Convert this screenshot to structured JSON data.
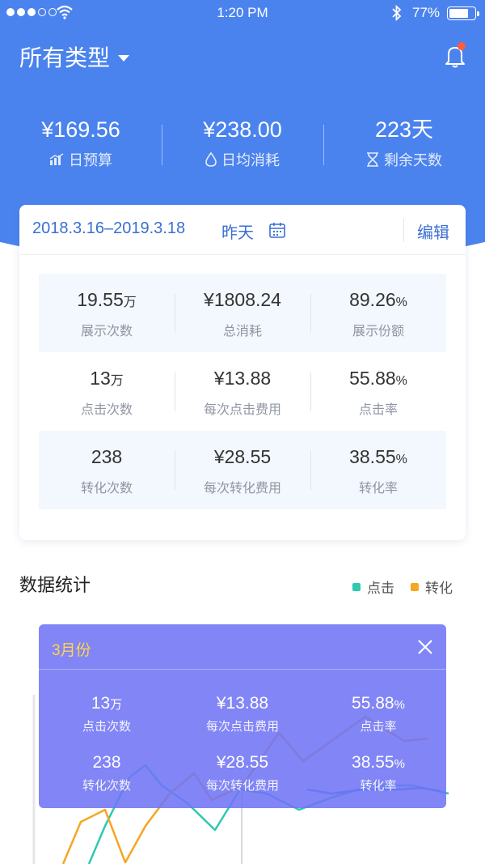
{
  "status_bar": {
    "time": "1:20 PM",
    "battery": "77%"
  },
  "header": {
    "title": "所有类型",
    "icons": [
      "dropdown-caret",
      "bell-icon"
    ]
  },
  "kpis": [
    {
      "value": "¥169.56",
      "label": "日预算",
      "icon": "chart-icon"
    },
    {
      "value": "¥238.00",
      "label": "日均消耗",
      "icon": "drop-icon"
    },
    {
      "value": "223天",
      "label": "剩余天数",
      "icon": "hourglass-icon"
    }
  ],
  "card": {
    "date_range": "2018.3.16–2019.3.18",
    "period": "昨天",
    "edit": "编辑",
    "rows": [
      [
        {
          "value": "19.55",
          "unit": "万",
          "label": "展示次数"
        },
        {
          "value": "¥1808.24",
          "unit": "",
          "label": "总消耗"
        },
        {
          "value": "89.26",
          "unit": "%",
          "label": "展示份额"
        }
      ],
      [
        {
          "value": "13",
          "unit": "万",
          "label": "点击次数"
        },
        {
          "value": "¥13.88",
          "unit": "",
          "label": "每次点击费用"
        },
        {
          "value": "55.88",
          "unit": "%",
          "label": "点击率"
        }
      ],
      [
        {
          "value": "238",
          "unit": "",
          "label": "转化次数"
        },
        {
          "value": "¥28.55",
          "unit": "",
          "label": "每次转化费用"
        },
        {
          "value": "38.55",
          "unit": "%",
          "label": "转化率"
        }
      ]
    ]
  },
  "stats": {
    "title": "数据统计",
    "legend": [
      {
        "name": "点击",
        "color": "#2ec9b0"
      },
      {
        "name": "转化",
        "color": "#f6a623"
      }
    ]
  },
  "tooltip": {
    "title": "3月份",
    "rows": [
      [
        {
          "value": "13",
          "unit": "万",
          "label": "点击次数"
        },
        {
          "value": "¥13.88",
          "unit": "",
          "label": "每次点击费用"
        },
        {
          "value": "55.88",
          "unit": "%",
          "label": "点击率"
        }
      ],
      [
        {
          "value": "238",
          "unit": "",
          "label": "转化次数"
        },
        {
          "value": "¥28.55",
          "unit": "",
          "label": "每次转化费用"
        },
        {
          "value": "38.55",
          "unit": "%",
          "label": "转化率"
        }
      ]
    ]
  },
  "colors": {
    "brand": "#4b83ee",
    "accent_text": "#3a6fd3",
    "tooltip_bg": "#7074f5",
    "tooltip_title": "#ffd54a",
    "row_shade": "#f3f8fe"
  }
}
